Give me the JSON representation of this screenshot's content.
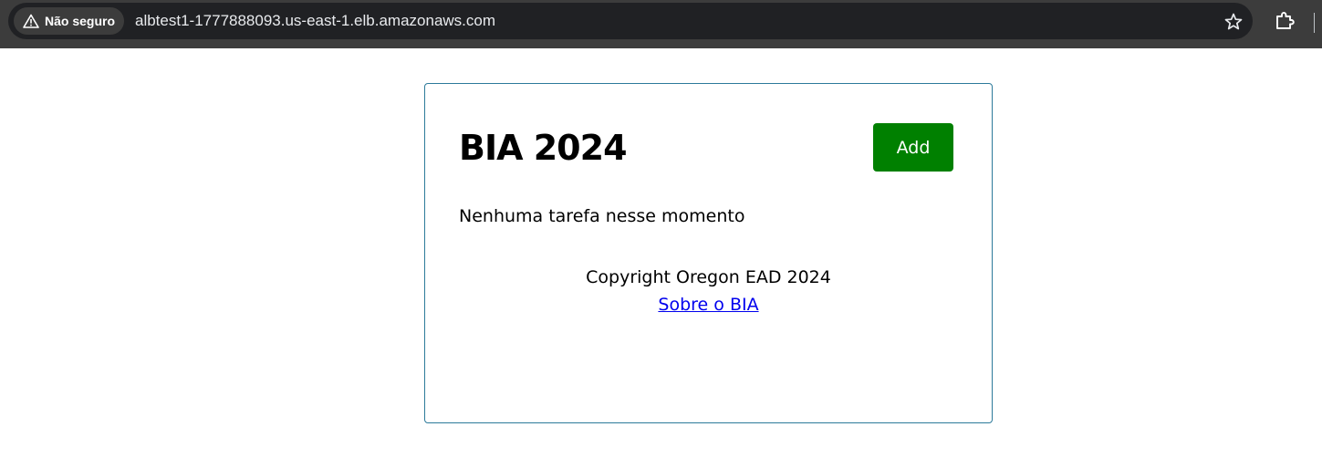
{
  "browser": {
    "security_label": "Não seguro",
    "url": "albtest1-1777888093.us-east-1.elb.amazonaws.com",
    "icons": {
      "security": "warning-triangle-icon",
      "bookmark": "star-icon",
      "extensions": "puzzle-icon"
    }
  },
  "page": {
    "title": "BIA 2024",
    "add_label": "Add",
    "empty_message": "Nenhuma tarefa nesse momento",
    "copyright": "Copyright Oregon EAD 2024",
    "about_link": "Sobre o BIA"
  },
  "colors": {
    "add_button": "#008000",
    "card_border": "#2c7a9a",
    "link": "#0000ee",
    "browser_bar": "#3c3c3c",
    "omnibox": "#202124"
  }
}
